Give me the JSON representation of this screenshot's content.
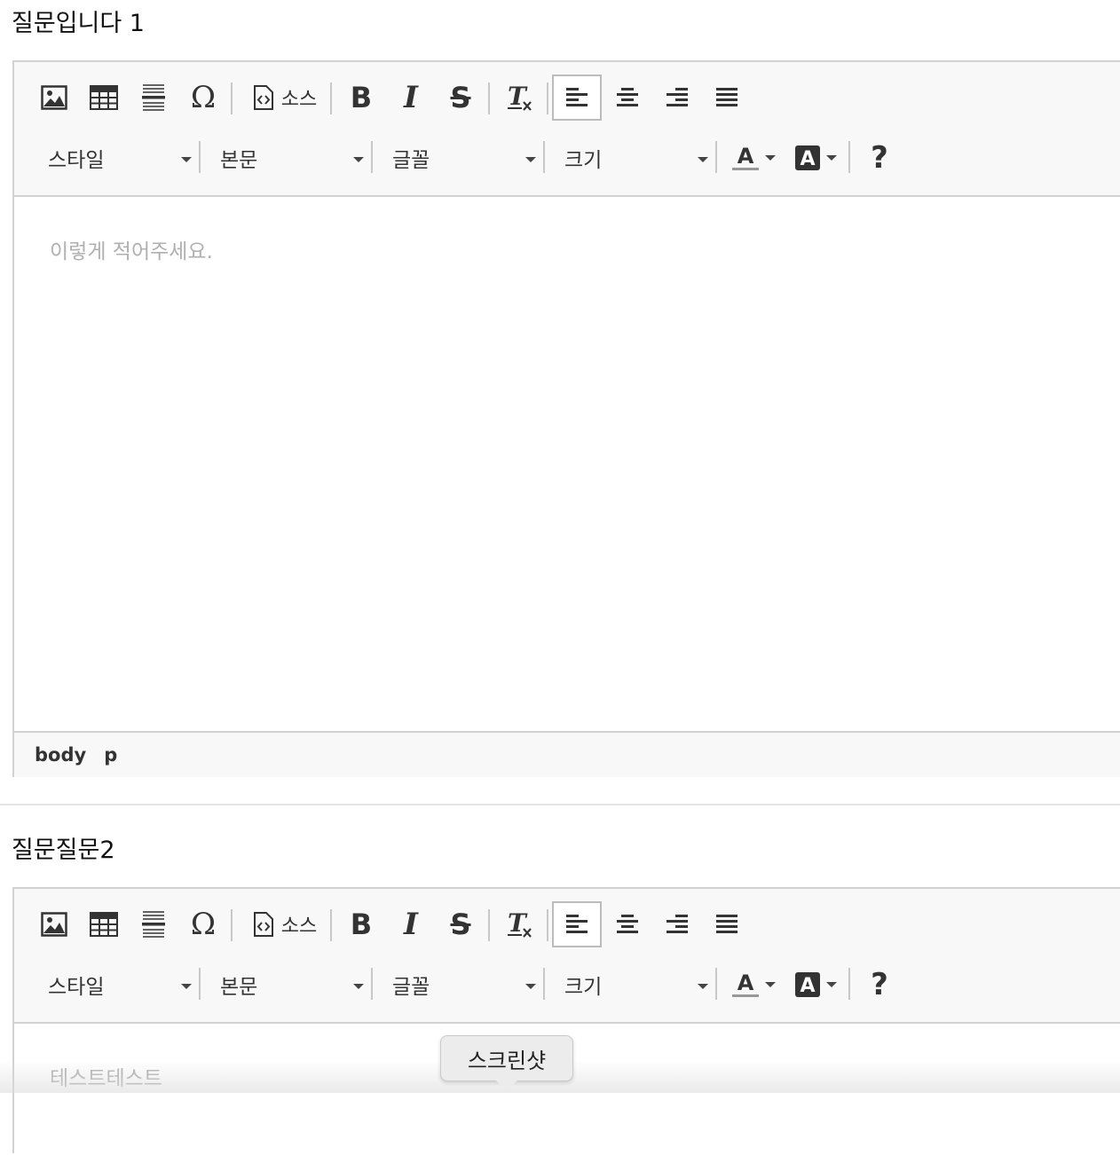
{
  "sections": [
    {
      "title": "질문입니다 1",
      "placeholder": "이렇게 적어주세요.",
      "status_path": [
        "body",
        "p"
      ]
    },
    {
      "title": "질문질문2",
      "placeholder": "테스트테스트"
    }
  ],
  "toolbar": {
    "source_label": "소스",
    "style_label": "스타일",
    "format_label": "본문",
    "font_label": "글꼴",
    "size_label": "크기",
    "help_label": "?",
    "icons": [
      "image-icon",
      "table-icon",
      "horizontal-line-icon",
      "special-char-icon",
      "source-icon",
      "bold-icon",
      "italic-icon",
      "strikethrough-icon",
      "clear-format-icon",
      "align-left-icon",
      "align-center-icon",
      "align-right-icon",
      "align-justify-icon",
      "text-color-icon",
      "bg-color-icon",
      "help-icon"
    ]
  },
  "tooltip": {
    "text": "스크린샷"
  },
  "colors": {
    "toolbar_bg": "#f8f8f8",
    "border": "#d1d1d1",
    "placeholder": "#b0b0b0"
  }
}
